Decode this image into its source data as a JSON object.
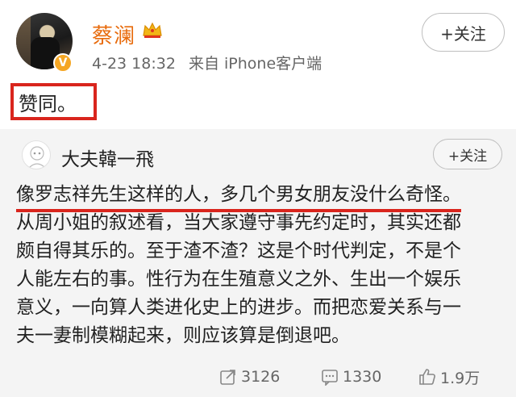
{
  "post": {
    "author": "蔡澜",
    "timestamp": "4-23 18:32",
    "source": "来自 iPhone客户端",
    "follow_label": "+关注",
    "text": "赞同。",
    "verified_mark": "V"
  },
  "repost": {
    "author": "大夫韓一飛",
    "follow_label": "+关注",
    "lines": [
      "像罗志祥先生这样的人，多几个男女朋友没什么奇怪。",
      "从周小姐的叙述看，当大家遵守事先约定时，其实还都",
      "颇自得其乐的。至于渣不渣？这是个时代判定，不是个",
      "人能左右的事。性行为在生殖意义之外、生出一个娱乐",
      "意义，一向算人类进化史上的进步。而把恋爱关系与一",
      "夫一妻制模糊起来，则应该算是倒退吧。"
    ],
    "stats": {
      "reposts": "3126",
      "comments": "1330",
      "likes": "1.9万"
    }
  },
  "colors": {
    "accent_orange": "#e86b0c",
    "highlight_red": "#d9251d",
    "repost_bg": "#f4f4f4"
  },
  "icons": [
    "crown-icon",
    "verified-badge-icon",
    "repost-icon",
    "comment-icon",
    "like-icon"
  ]
}
